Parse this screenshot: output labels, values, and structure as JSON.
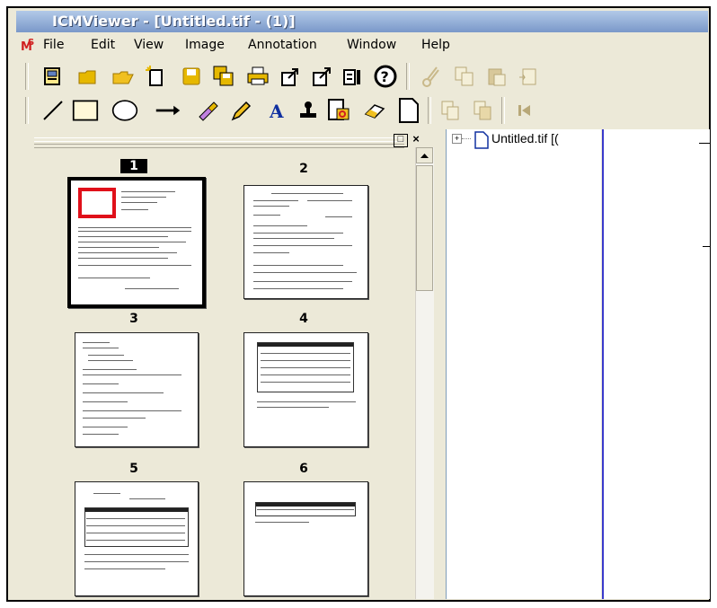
{
  "window": {
    "title": "ICMViewer - [Untitled.tif - (1)]"
  },
  "menu": {
    "items": [
      "File",
      "Edit",
      "View",
      "Image",
      "Annotation",
      "Window",
      "Help"
    ]
  },
  "toolbar_main": {
    "icons": [
      "scan-icon",
      "open-folder-icon",
      "open-icon",
      "new-icon",
      "save-icon",
      "save-as-icon",
      "print-icon",
      "export-icon",
      "export-all-icon",
      "properties-icon",
      "help-icon",
      "cut-icon",
      "copy-icon",
      "paste-icon",
      "paste-special-icon"
    ]
  },
  "toolbar_annotation": {
    "icons": [
      "line-icon",
      "rectangle-icon",
      "ellipse-icon",
      "arrow-icon",
      "highlighter-icon",
      "pencil-icon",
      "text-icon",
      "stamp-icon",
      "attach-icon",
      "eraser-icon",
      "blank-page-icon",
      "insert-page-icon",
      "append-page-icon",
      "first-page-icon"
    ]
  },
  "thumbnails": {
    "pages": [
      {
        "label": "1",
        "selected": true
      },
      {
        "label": "2",
        "selected": false
      },
      {
        "label": "3",
        "selected": false
      },
      {
        "label": "4",
        "selected": false
      },
      {
        "label": "5",
        "selected": false
      },
      {
        "label": "6",
        "selected": false
      }
    ],
    "panel_controls": {
      "restore": "□",
      "close": "×"
    }
  },
  "tree": {
    "expander": "+",
    "root_label": "Untitled.tif [("
  },
  "colors": {
    "title_gradient_top": "#b2c9e8",
    "title_gradient_bottom": "#7a98c9",
    "selection": "#000000",
    "redaction": "#e0101a",
    "doc_border": "#3a3acb"
  }
}
